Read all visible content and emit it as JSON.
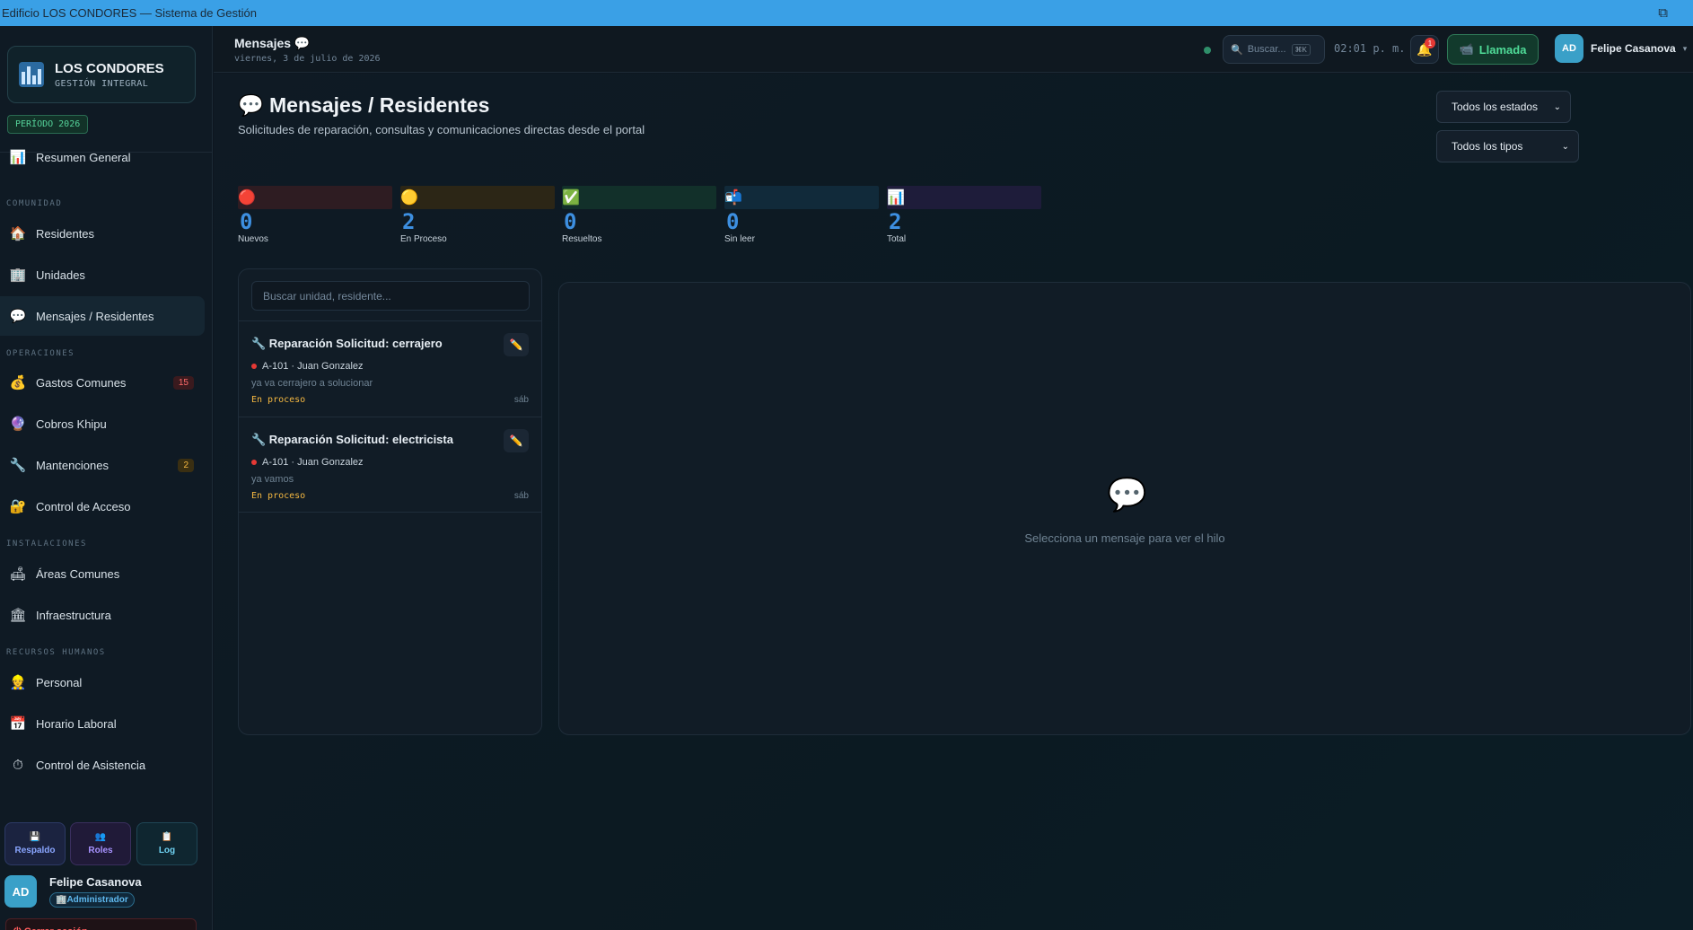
{
  "window": {
    "title": "Edificio LOS CONDORES — Sistema de Gestión"
  },
  "sidebar": {
    "brand_title": "LOS CONDORES",
    "brand_subtitle": "GESTIÓN INTEGRAL",
    "period": "PERÍODO 2026",
    "sections": {
      "comunidad": "COMUNIDAD",
      "operaciones": "OPERACIONES",
      "instalaciones": "INSTALACIONES",
      "rrhh": "RECURSOS HUMANOS"
    },
    "items": [
      {
        "label": "Resumen General",
        "icon": "📊",
        "icon_name": "chart-icon"
      },
      {
        "label": "Residentes",
        "icon": "🏠",
        "icon_name": "house-icon"
      },
      {
        "label": "Unidades",
        "icon": "🏢",
        "icon_name": "building-icon"
      },
      {
        "label": "Mensajes / Residentes",
        "icon": "💬",
        "icon_name": "chat-icon",
        "active": true
      },
      {
        "label": "Gastos Comunes",
        "icon": "💰",
        "icon_name": "money-bag-icon",
        "badge": "15"
      },
      {
        "label": "Cobros Khipu",
        "icon": "🔮",
        "icon_name": "crystal-ball-icon"
      },
      {
        "label": "Mantenciones",
        "icon": "🔧",
        "icon_name": "wrench-icon",
        "badge": "2"
      },
      {
        "label": "Control de Acceso",
        "icon": "🔐",
        "icon_name": "lock-icon"
      },
      {
        "label": "Áreas Comunes",
        "icon": "🛋",
        "icon_name": "couch-icon"
      },
      {
        "label": "Infraestructura",
        "icon": "🏛",
        "icon_name": "classical-building-icon"
      },
      {
        "label": "Personal",
        "icon": "👷",
        "icon_name": "worker-icon"
      },
      {
        "label": "Horario Laboral",
        "icon": "📅",
        "icon_name": "calendar-icon"
      },
      {
        "label": "Control de Asistencia",
        "icon": "⏱",
        "icon_name": "stopwatch-icon"
      }
    ],
    "quick_buttons": [
      {
        "label": "Respaldo",
        "icon": "💾"
      },
      {
        "label": "Roles",
        "icon": "👥"
      },
      {
        "label": "Log",
        "icon": "📋"
      }
    ],
    "user": {
      "initials": "AD",
      "name": "Felipe Casanova",
      "role": "Administrador",
      "role_icon": "🏢"
    },
    "logout": "⏻ Cerrar sesión"
  },
  "topbar": {
    "title": "Mensajes 💬",
    "date": "viernes, 3 de julio de 2026",
    "search_placeholder": "Buscar...",
    "search_kbd": "⌘K",
    "clock": "02:01 p. m.",
    "bell_icon": "🔔",
    "notification_count": "1",
    "call_label": "Llamada",
    "call_icon": "📹",
    "user_initials": "AD",
    "user_name": "Felipe Casanova"
  },
  "main": {
    "title": "💬 Mensajes / Residentes",
    "subtitle": "Solicitudes de reparación, consultas y comunicaciones directas desde el portal",
    "filter_status": "Todos los estados",
    "filter_type": "Todos los tipos",
    "stats": [
      {
        "icon": "🔴",
        "value": "0",
        "label": "Nuevos",
        "color": "#2e1c22"
      },
      {
        "icon": "🟡",
        "value": "2",
        "label": "En Proceso",
        "color": "#2c2616"
      },
      {
        "icon": "✅",
        "value": "0",
        "label": "Resueltos",
        "color": "#12302a"
      },
      {
        "icon": "📬",
        "value": "0",
        "label": "Sin leer",
        "color": "#112a3a"
      },
      {
        "icon": "📊",
        "value": "2",
        "label": "Total",
        "color": "#1e1c3a"
      }
    ],
    "list_search_placeholder": "Buscar unidad, residente...",
    "messages": [
      {
        "title": "🔧 Reparación Solicitud: cerrajero",
        "unit": "A-101 · Juan Gonzalez",
        "preview": "ya va cerrajero a solucionar",
        "status": "En proceso",
        "day": "sáb"
      },
      {
        "title": "🔧 Reparación Solicitud: electricista",
        "unit": "A-101 · Juan Gonzalez",
        "preview": "ya vamos",
        "status": "En proceso",
        "day": "sáb"
      }
    ],
    "empty_icon": "💬",
    "empty_text": "Selecciona un mensaje para ver el hilo"
  }
}
